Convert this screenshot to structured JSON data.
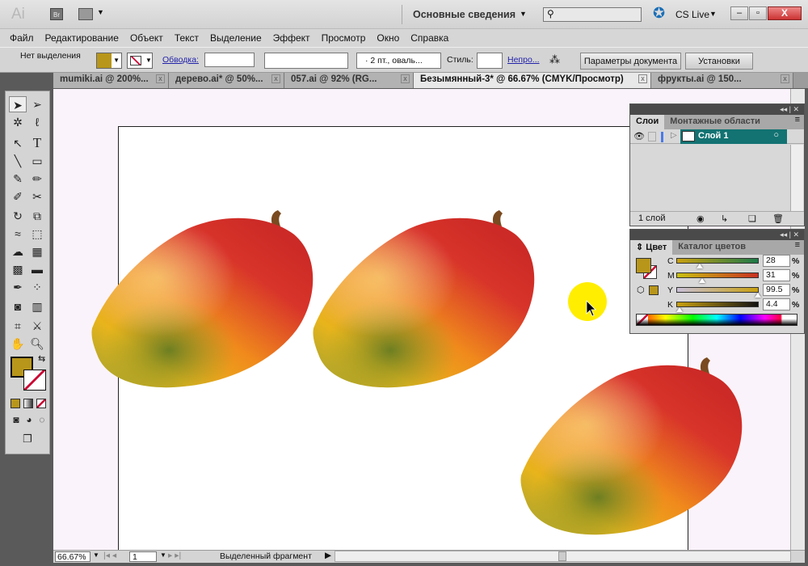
{
  "app": {
    "logo": "Ai",
    "bridge": "Br",
    "workspace": "Основные сведения",
    "cs_live": "CS Live",
    "search_placeholder": ""
  },
  "menu": [
    "Файл",
    "Редактирование",
    "Объект",
    "Текст",
    "Выделение",
    "Эффект",
    "Просмотр",
    "Окно",
    "Справка"
  ],
  "control": {
    "selection": "Нет выделения",
    "stroke_label": "Обводка:",
    "brush": "2 пт., оваль...",
    "style_label": "Стиль:",
    "opacity": "Непро...",
    "doc_settings": "Параметры документа",
    "preferences": "Установки",
    "fill_color": "#b8961a"
  },
  "tabs": [
    {
      "label": "mumiki.ai @ 200%..."
    },
    {
      "label": "дерево.ai* @ 50%..."
    },
    {
      "label": "057.ai @ 92% (RG..."
    },
    {
      "label": "Безымянный-3* @ 66.67% (CMYK/Просмотр)"
    },
    {
      "label": "фрукты.ai @ 150..."
    }
  ],
  "layers": {
    "tabs": [
      "Слои",
      "Монтажные области"
    ],
    "layer_name": "Слой 1",
    "count": "1 слой"
  },
  "color": {
    "tabs": [
      "Цвет",
      "Каталог цветов"
    ],
    "channels": [
      {
        "label": "C",
        "value": "28",
        "pos": 0.28
      },
      {
        "label": "M",
        "value": "31",
        "pos": 0.31
      },
      {
        "label": "Y",
        "value": "99.5",
        "pos": 0.995
      },
      {
        "label": "K",
        "value": "4.4",
        "pos": 0.044
      }
    ],
    "unit": "%",
    "swatch": "#b8961a"
  },
  "status": {
    "zoom": "66.67%",
    "page": "1",
    "info": "Выделенный фрагмент"
  }
}
